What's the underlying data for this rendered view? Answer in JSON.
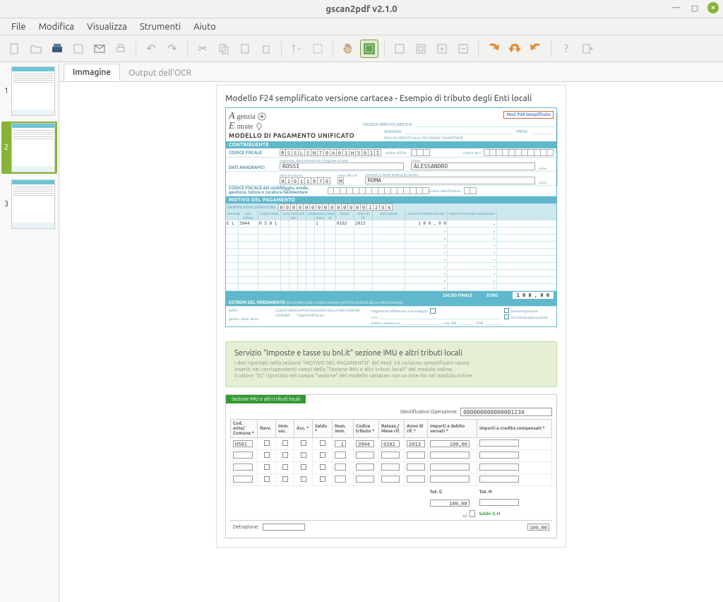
{
  "window": {
    "title": "gscan2pdf v2.1.0"
  },
  "menu": {
    "file": "File",
    "edit": "Modifica",
    "view": "Visualizza",
    "tools": "Strumenti",
    "help": "Aiuto"
  },
  "thumbs": {
    "p1": "1",
    "p2": "2",
    "p3": "3"
  },
  "tabs": {
    "image": "Immagine",
    "ocr": "Output dell'OCR"
  },
  "tooltips": {
    "new": "New",
    "open": "Open",
    "scan": "Scan",
    "save": "Save",
    "email": "Email",
    "print": "Print",
    "undo": "Undo",
    "redo": "Redo",
    "cut": "Cut",
    "copy": "Copy",
    "paste": "Paste",
    "delete": "Delete",
    "renumber": "Renumber",
    "select_all": "Select all",
    "pan": "Pan",
    "select": "Select",
    "zoom100": "Zoom 100%",
    "zoomfit": "Zoom fit",
    "zoomin": "Zoom in",
    "zoomout": "Zoom out",
    "rotcw": "Rotate CW",
    "rot180": "Rotate 180",
    "rotccw": "Rotate CCW",
    "help": "Help",
    "quit": "Quit"
  },
  "doc": {
    "heading": "Modello F24 semplificato versione cartacea - Esempio di tributo degli Enti locali",
    "badge_mod": "Mod.",
    "badge_f24": "F24",
    "badge_semp": "Semplificato",
    "agenzia": "genzia",
    "entrate": "ntrate",
    "title": "MODELLO DI PAGAMENTO UNIFICATO",
    "delega_label": "DELEGA IRREVOCABILE A:",
    "agenzia_label": "AGENZIA",
    "prov_label": "PROV.",
    "accredito": "PER L'ACCREDITO ALLA TESORERIA COMPETENTE",
    "contribuente": "CONTRIBUENTE",
    "codice_fiscale": "CODICE FISCALE",
    "cf_value": "RSSLSN70A01H501I",
    "dati_anagrafici": "DATI ANAGRAFICI",
    "cognome_hint": "cognome, denominazione o ragione sociale",
    "nome_hint": "nome",
    "cognome": "ROSSI",
    "nome": "ALESSANDRO",
    "data_nascita_hint": "data di nascita",
    "data_nascita": "01011970",
    "sesso_hint": "sesso (M o F)",
    "sesso": "M",
    "comune_hint": "comune (o Stato estero) di nascita",
    "comune": "ROMA",
    "prov_hint": "prov.",
    "cf_coobbligato": "CODICE FISCALE del coobbligato, erede, genitore, tutore o curatore fallimentare",
    "codice_id_hint": "codice identificativo",
    "motivo": "MOTIVO DEL PAGAMENTO",
    "id_op_label": "IDENTIFICATIVO OPERAZIONE",
    "id_op_value": "000000000000001234",
    "col_sezione": "Sezione",
    "col_tributo": "cod. tributo",
    "col_ente": "codice ente",
    "col_ravv": "ravv.",
    "col_immvar": "imm. var.",
    "col_acc": "acc.",
    "col_saldo": "saldo",
    "col_numimm": "num. imm.",
    "col_mese": "mese rif.",
    "col_rate": "rateaz.",
    "col_anno": "anno di rif.",
    "col_detr": "detrazione",
    "col_deb": "importi a debito versati",
    "col_cred": "importi a credito compensati",
    "row_sez": "E L",
    "row_trib": "3944",
    "row_ente": "H 5 0 1",
    "row_numimm": "1",
    "row_rate": "0102",
    "row_anno": "2013",
    "row_deb": "1 0 0 , 0 0",
    "saldo_label": "SALDO FINALE",
    "euro_label": "EURO",
    "saldo_value": "1 0 0 , 0 0",
    "estremi": "ESTREMI DEL VERSAMENTO",
    "estremi_hint": "(DA COMPILARE A CURA DI BANCA/POSTE/AGENTE DELLA RISCOSSIONE)",
    "data_label": "DATA",
    "codice_banca": "CODICE BANCA/POSTE/AGENTE DELLA RISCOSSIONE",
    "azienda": "AZIENDA",
    "cab": "CAB/SPORTELLO",
    "giorno": "giorno",
    "mese": "mese",
    "anno": "anno",
    "pag_assegno": "Pagamento effettuato con assegno",
    "nro": "n.ro",
    "tratto": "tratto / emesso su",
    "codabi": "cod. ABI",
    "cablbl": "CAB",
    "bancario": "bancario/postale",
    "circolare": "circolare/vaglia postale"
  },
  "note": {
    "title": "Servizio \"Imposte e tasse su bnl.it\" sezione IMU e altri tributi locali",
    "line1": "I dati riportati nella sezione \"MOTIVO DEL PAGAMENTO\" del Mod. 24 cartaceo semplificato vanno",
    "line2": "inseriti nei corrispondenti campi della \"Sezione IMU e altri tributi locali\" del modulo online.",
    "line3": "Il valore \"EL\" riportato nel campo \"sezione\" del modello cartaceo non va inserito nel modulo online."
  },
  "online": {
    "tab": "Sezione IMU e altri tributi locali",
    "id_label": "Identificativo Operazione:",
    "id_value": "000000000000001234",
    "col_ente": "Cod. ente/ Comune *",
    "col_ravv": "Ravv.",
    "col_immvar": "Imm. var.",
    "col_acc": "Acc. *",
    "col_saldo": "Saldo *",
    "col_numimm": "Num. imm.",
    "col_tributo": "Codice tributo *",
    "col_rate": "Rateaz./ Mese rif.",
    "col_anno": "Anno di rif. *",
    "col_deb": "Importi a debito versati *",
    "col_cred": "Importi a credito compensati *",
    "r_ente": "H501",
    "r_numimm": "1",
    "r_trib": "3944",
    "r_rate": "0102",
    "r_anno": "2013",
    "r_deb": "100,00",
    "totg": "Tot. G",
    "toth": "Tot. H",
    "totg_val": "100,00",
    "plusminus": "+/-",
    "saldogh": "Saldo G-H",
    "saldo_val": "100,00",
    "detrazione": "Detrazione:"
  }
}
